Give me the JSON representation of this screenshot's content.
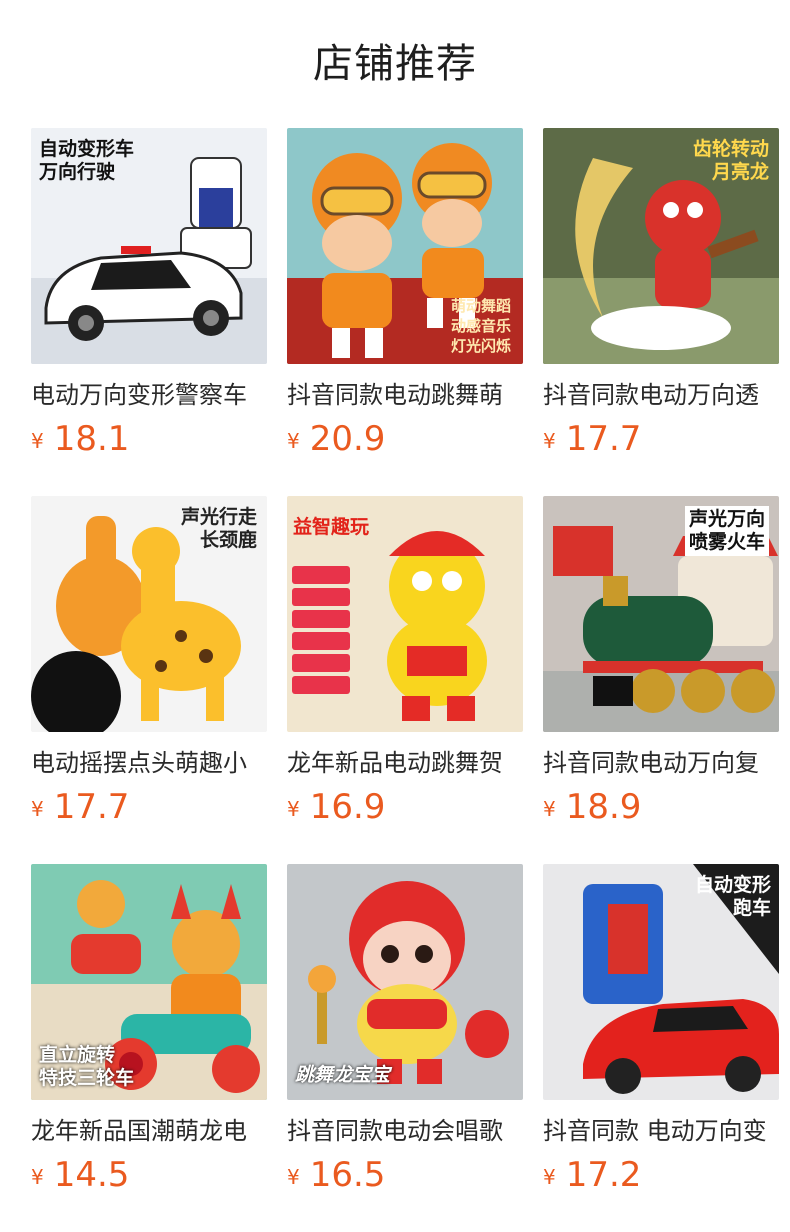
{
  "page": {
    "title": "店铺推荐"
  },
  "currency_symbol": "¥",
  "accent_color": "#ea5a1f",
  "products": [
    {
      "name": "电动万向变形警察车",
      "price": "18.1",
      "badge": "自动变形车\n万向行驶"
    },
    {
      "name": "抖音同款电动跳舞萌",
      "price": "20.9",
      "badge": "萌动舞蹈\n动感音乐\n灯光闪烁"
    },
    {
      "name": "抖音同款电动万向透",
      "price": "17.7",
      "badge": "齿轮转动\n月亮龙"
    },
    {
      "name": "电动摇摆点头萌趣小",
      "price": "17.7",
      "badge": "声光行走\n长颈鹿"
    },
    {
      "name": "龙年新品电动跳舞贺",
      "price": "16.9",
      "badge": "益智趣玩"
    },
    {
      "name": "抖音同款电动万向复",
      "price": "18.9",
      "badge": "声光万向\n喷雾火车"
    },
    {
      "name": "龙年新品国潮萌龙电",
      "price": "14.5",
      "badge": "直立旋转\n特技三轮车"
    },
    {
      "name": "抖音同款电动会唱歌",
      "price": "16.5",
      "badge": "跳舞龙宝宝"
    },
    {
      "name": "抖音同款 电动万向变",
      "price": "17.2",
      "badge": "自动变形\n跑车"
    }
  ]
}
